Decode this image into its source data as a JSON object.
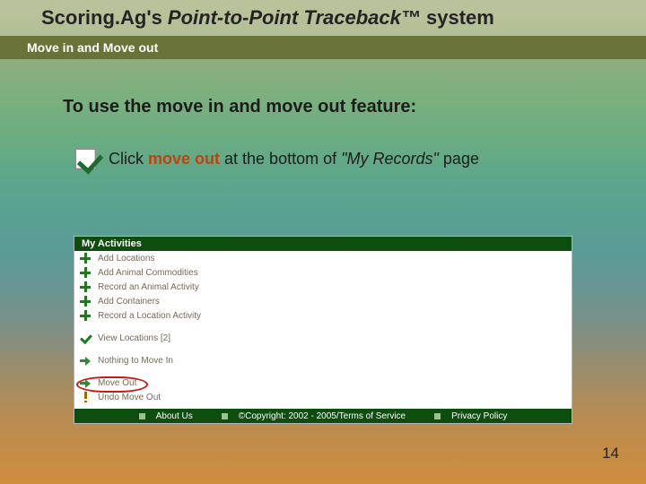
{
  "title": {
    "prefix": "Scoring.Ag's ",
    "main_italic": "Point-to-Point Traceback™",
    "suffix": " system"
  },
  "subtitle": "Move in and Move out",
  "headline": "To use the move in and move out feature:",
  "bullet": {
    "prefix": "Click ",
    "action": "move out",
    "mid": "  at the bottom of ",
    "quote": "\"My Records\"",
    "suffix": " page"
  },
  "panel": {
    "header": "My Activities",
    "items": [
      {
        "icon": "plus",
        "label": "Add Locations"
      },
      {
        "icon": "plus",
        "label": "Add Animal Commodities"
      },
      {
        "icon": "plus",
        "label": "Record an Animal Activity"
      },
      {
        "icon": "plus",
        "label": "Add Containers"
      },
      {
        "icon": "plus",
        "label": "Record a Location Activity"
      }
    ],
    "view": {
      "icon": "tick",
      "label": "View Locations [2]"
    },
    "movein": {
      "icon": "arrow",
      "label": "Nothing to Move In"
    },
    "moveout": {
      "icon": "arrow",
      "label": "Move Out"
    },
    "undo": {
      "icon": "bang",
      "label": "Undo Move Out"
    },
    "footer": {
      "about": "About Us",
      "copyright": "©Copyright: 2002 - 2005/Terms of Service",
      "privacy": "Privacy Policy"
    }
  },
  "page_number": "14"
}
